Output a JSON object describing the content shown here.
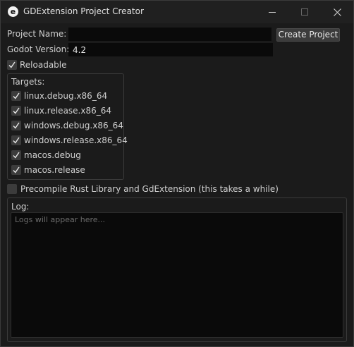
{
  "window": {
    "title": "GDExtension Project Creator",
    "app_icon_letter": "e"
  },
  "form": {
    "project_name_label": "Project Name:",
    "project_name_value": "",
    "create_button_label": "Create Project",
    "godot_version_label": "Godot Version:",
    "godot_version_value": "4.2",
    "reloadable_label": "Reloadable",
    "reloadable_checked": true
  },
  "targets": {
    "heading": "Targets:",
    "items": [
      {
        "label": "linux.debug.x86_64",
        "checked": true
      },
      {
        "label": "linux.release.x86_64",
        "checked": true
      },
      {
        "label": "windows.debug.x86_64",
        "checked": true
      },
      {
        "label": "windows.release.x86_64",
        "checked": true
      },
      {
        "label": "macos.debug",
        "checked": true
      },
      {
        "label": "macos.release",
        "checked": true
      }
    ]
  },
  "precompile": {
    "label": "Precompile Rust Library and GdExtension (this takes a while)",
    "checked": false
  },
  "log": {
    "heading": "Log:",
    "placeholder": "Logs will appear here..."
  }
}
